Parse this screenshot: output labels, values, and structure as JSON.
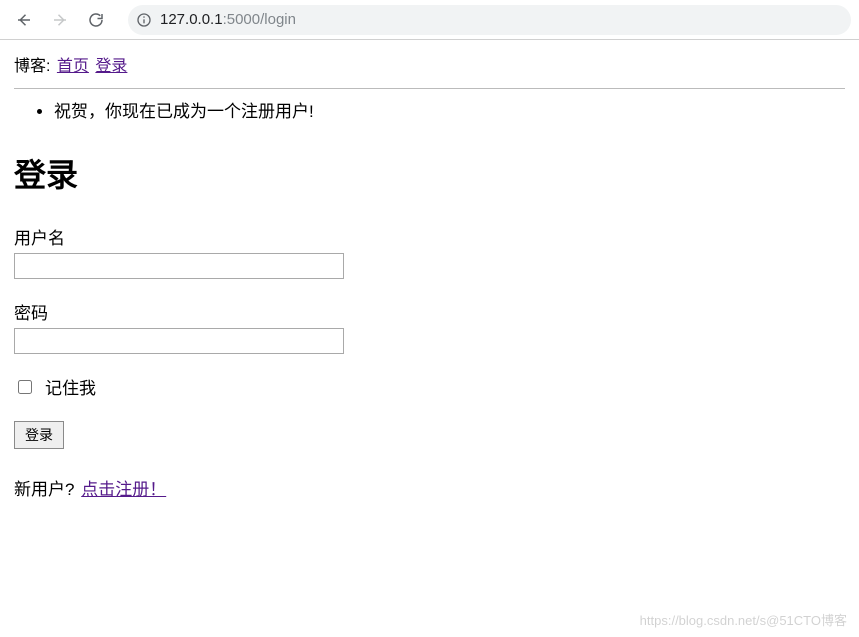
{
  "browser": {
    "url_host": "127.0.0.1",
    "url_port_path": ":5000/login"
  },
  "nav": {
    "label": "博客:",
    "home": "首页",
    "login": "登录"
  },
  "flash": {
    "message": "祝贺，你现在已成为一个注册用户!"
  },
  "page": {
    "heading": "登录"
  },
  "form": {
    "username_label": "用户名",
    "username_value": "",
    "password_label": "密码",
    "password_value": "",
    "remember_label": "记住我",
    "submit_label": "登录"
  },
  "register": {
    "prompt": "新用户?",
    "link_text": "点击注册！"
  },
  "watermark": {
    "left": "https://blog.csdn.net/s",
    "right": "@51CTO博客"
  }
}
